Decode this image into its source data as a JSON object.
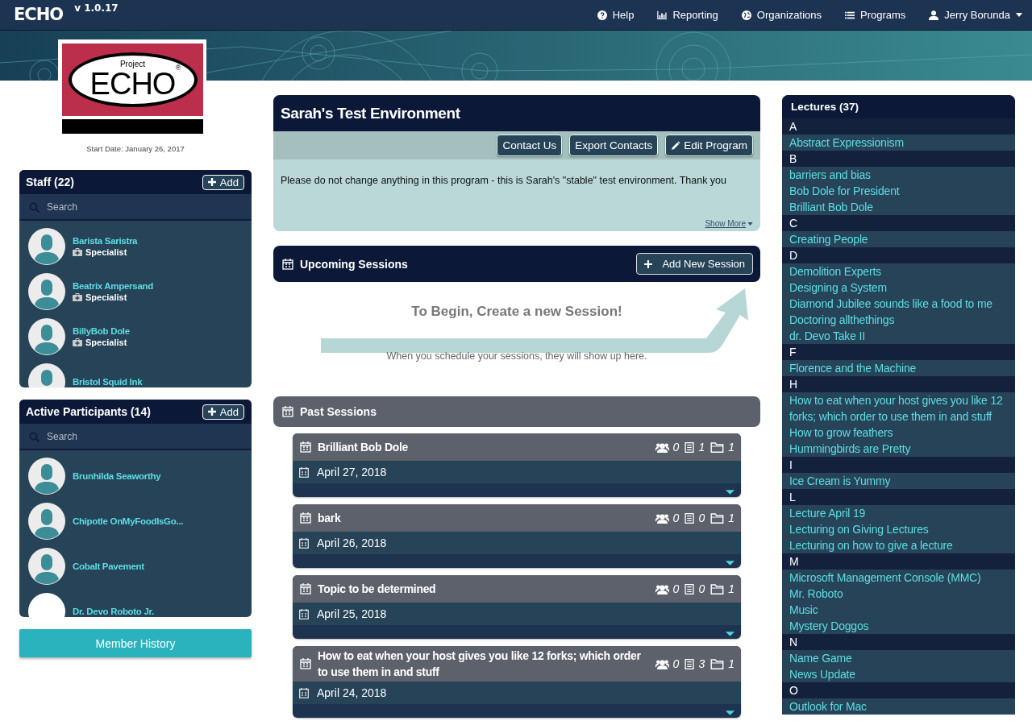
{
  "nav": {
    "logo": "ECHO",
    "version": "v 1.0.17",
    "items": [
      {
        "kind": "help",
        "label": "Help"
      },
      {
        "kind": "chart",
        "label": "Reporting"
      },
      {
        "kind": "globe",
        "label": "Organizations"
      },
      {
        "kind": "list",
        "label": "Programs"
      },
      {
        "kind": "user",
        "label": "Jerry Borunda"
      }
    ]
  },
  "program_logo": {
    "top": "Project",
    "main": "ECHO",
    "mark": "®"
  },
  "start_date": "Start Date: January 26, 2017",
  "staff": {
    "title": "Staff (22)",
    "add": "Add",
    "search": {
      "placeholder": "Search"
    },
    "members": [
      {
        "name": "Barista Saristra",
        "role": "Specialist",
        "kind": "silhouette"
      },
      {
        "name": "Beatrix Ampersand",
        "role": "Specialist",
        "kind": "silhouette"
      },
      {
        "name": "BillyBob Dole",
        "role": "Specialist",
        "kind": "silhouette"
      },
      {
        "name": "Bristol Squid Ink",
        "kind": "silhouette"
      }
    ]
  },
  "participants": {
    "title": "Active Participants (14)",
    "add": "Add",
    "search": {
      "placeholder": "Search"
    },
    "members": [
      {
        "name": "Brunhilda Seaworthy",
        "kind": "silhouette"
      },
      {
        "name": "Chipotle OnMyFoodIsGo...",
        "kind": "silhouette"
      },
      {
        "name": "Cobalt Pavement",
        "kind": "silhouette"
      },
      {
        "name": "Dr. Devo Roboto Jr.",
        "kind": "blank"
      }
    ]
  },
  "member_history": "Member History",
  "program": {
    "title": "Sarah's Test Environment",
    "buttons": [
      {
        "kind": "plain",
        "label": "Contact Us"
      },
      {
        "kind": "plain",
        "label": "Export Contacts"
      },
      {
        "kind": "edit",
        "label": "Edit Program"
      }
    ],
    "description": "Please do not change anything in this program - this is Sarah's \"stable\" test environment. Thank you",
    "show_more": "Show More"
  },
  "upcoming": {
    "title": "Upcoming Sessions",
    "add": "Add New Session",
    "empty_title": "To Begin, Create a new Session!",
    "empty_text": "When you schedule your sessions, they will show up here."
  },
  "past": {
    "title": "Past Sessions",
    "sessions": [
      {
        "title": "Brilliant Bob Dole",
        "participants": "0",
        "lectures": "1",
        "files": "1",
        "date": "April 27, 2018"
      },
      {
        "title": "bark",
        "participants": "0",
        "lectures": "0",
        "files": "1",
        "date": "April 26, 2018"
      },
      {
        "title": "Topic to be determined",
        "participants": "0",
        "lectures": "0",
        "files": "1",
        "date": "April 25, 2018"
      },
      {
        "title": "How to eat when your host gives you like 12 forks; which order to use them in and stuff",
        "participants": "0",
        "lectures": "3",
        "files": "1",
        "date": "April 24, 2018"
      }
    ]
  },
  "lectures": {
    "title": "Lectures (37)",
    "groups": [
      {
        "letter": "A",
        "items": [
          "Abstract Expressionism"
        ]
      },
      {
        "letter": "B",
        "items": [
          "barriers and bias",
          "Bob Dole for President",
          "Brilliant Bob Dole"
        ]
      },
      {
        "letter": "C",
        "items": [
          "Creating People"
        ]
      },
      {
        "letter": "D",
        "items": [
          "Demolition Experts",
          "Designing a System",
          "Diamond Jubilee sounds like a food to me",
          "Doctoring allthethings",
          "dr. Devo Take II"
        ]
      },
      {
        "letter": "F",
        "items": [
          "Florence and the Machine"
        ]
      },
      {
        "letter": "H",
        "items": [
          "How to eat when your host gives you like 12 forks; which order to use them in and stuff",
          "How to grow feathers",
          "Hummingbirds are Pretty"
        ]
      },
      {
        "letter": "I",
        "items": [
          "Ice Cream is Yummy"
        ]
      },
      {
        "letter": "L",
        "items": [
          "Lecture April 19",
          "Lecturing on Giving Lectures",
          "Lecturing on how to give a lecture"
        ]
      },
      {
        "letter": "M",
        "items": [
          "Microsoft Management Console (MMC)",
          "Mr. Roboto",
          "Music",
          "Mystery Doggos"
        ]
      },
      {
        "letter": "N",
        "items": [
          "Name Game",
          "News Update"
        ]
      },
      {
        "letter": "O",
        "items": [
          "Outlook for Mac"
        ]
      }
    ]
  }
}
